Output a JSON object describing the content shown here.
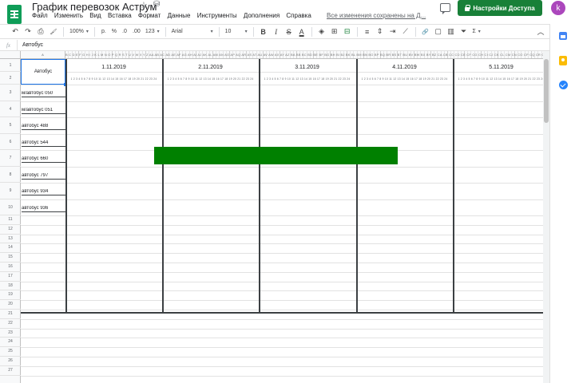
{
  "title_bar": {
    "doc_title": "График перевозок Аструм",
    "star_icon": "star-icon",
    "move_icon": "cloud-status-icon",
    "menus": [
      "Файл",
      "Изменить",
      "Вид",
      "Вставка",
      "Формат",
      "Данные",
      "Инструменты",
      "Дополнения",
      "Справка"
    ],
    "saved_status": "Все изменения сохранены на Д...",
    "share_label": "Настройки Доступа",
    "avatar_letter": "k",
    "brand_color": "#0f9d58",
    "share_color": "#188038"
  },
  "toolbar": {
    "undo": "↶",
    "redo": "↷",
    "print": "⎙",
    "paint_format": "🖌",
    "zoom": "100%",
    "currency": "р.",
    "percent": "%",
    "decrease_decimals": ".0",
    "increase_decimals": ".00",
    "number_format": "123",
    "font": "Arial",
    "font_size": "10",
    "bold": "B",
    "italic": "I",
    "strikethrough": "S",
    "text_color": "A",
    "fill_color": "◈",
    "borders": "⊞",
    "merge": "⊟",
    "h_align": "≡",
    "v_align": "⇕",
    "wrap": "⇥",
    "rotate": "⟋",
    "link": "🔗",
    "comment": "▢",
    "chart": "▥",
    "filter": "⏷",
    "functions": "Σ",
    "collapse": "︿"
  },
  "formula_bar": {
    "fx": "fx",
    "value": "Автобус"
  },
  "sheet": {
    "column_a": "A",
    "column_strip": "B C D E F G H I J K L M N O P Q R S T U V W X Y Z AA AB AC AD AE AF AG AH AI AJ AK AL AM AN AO AP AQ AR AS AT AU AV AW AX AY AZ BA BB BC BD BE BF BG BH BI BJ BK BL BM BN BO BP BQ BR BS BT BU BV BW BX BY BZ CA CB CC CD CE CF CG CH CI CJ CK CL CM CN CO CP CQ CR CS CT CU CV CW CX CY CZ DA DB DC DD DE DF",
    "row_numbers": [
      "1",
      "2",
      "3",
      "4",
      "5",
      "6",
      "7",
      "8",
      "9",
      "10",
      "11",
      "12",
      "13",
      "14",
      "15",
      "16",
      "17",
      "18",
      "19",
      "20",
      "21",
      "22",
      "23",
      "24",
      "25",
      "26",
      "27"
    ],
    "header_cell": "Автобус",
    "buses": [
      "м/автобус 050",
      "м/автобус 051",
      "автобус 488",
      "автобус 544",
      "автобус 660",
      "автобус 797",
      "автобус 934",
      "автобус 936"
    ],
    "dates": [
      "1.11.2019",
      "2.11.2019",
      "3.11.2019",
      "4.11.2019",
      "5.11.2019"
    ],
    "hours": "1 2 3 4 5 6 7 8 9 10 11 12 13 14 15 16 17 18 19 20 21 22 23 24",
    "trip_bar_color": "#008000"
  },
  "side_panel": {
    "calendar_icon": "calendar-icon",
    "keep_icon": "keep-icon",
    "tasks_icon": "tasks-icon"
  }
}
